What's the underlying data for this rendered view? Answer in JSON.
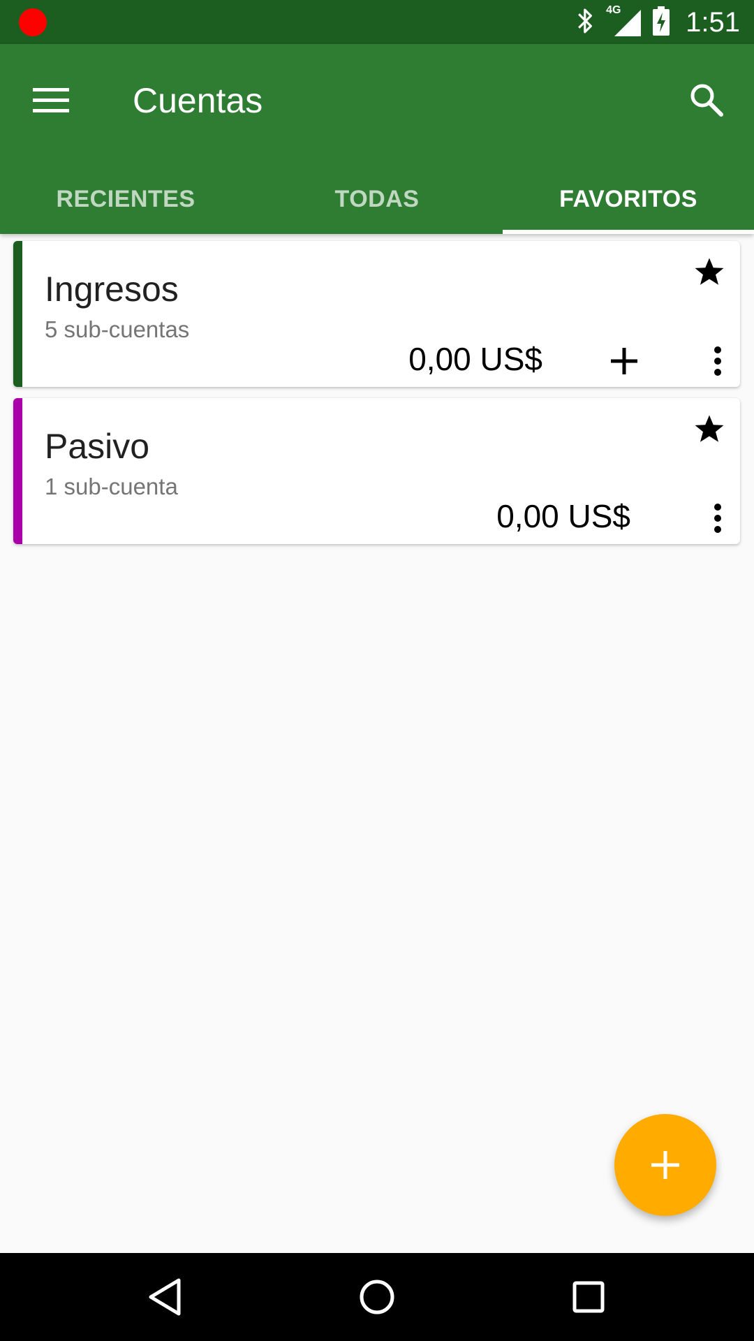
{
  "status_bar": {
    "time": "1:51",
    "network": "4G",
    "icons": [
      "recording-icon",
      "bluetooth-icon",
      "cell-signal-icon",
      "battery-charging-icon"
    ]
  },
  "app_bar": {
    "title": "Cuentas",
    "menu_icon": "hamburger-menu-icon",
    "search_icon": "search-icon"
  },
  "tabs": [
    {
      "label": "RECIENTES",
      "active": false
    },
    {
      "label": "TODAS",
      "active": false
    },
    {
      "label": "FAVORITOS",
      "active": true
    }
  ],
  "accounts": [
    {
      "name": "Ingresos",
      "subaccounts": "5 sub-cuentas",
      "balance": "0,00 US$",
      "color": "#1b5e20",
      "favorite": true,
      "has_add": true
    },
    {
      "name": "Pasivo",
      "subaccounts": "1 sub-cuenta",
      "balance": "0,00 US$",
      "color": "#aa00aa",
      "favorite": true,
      "has_add": false
    }
  ],
  "fab": {
    "icon": "plus-icon"
  },
  "nav_bar": {
    "icons": [
      "back-icon",
      "home-icon",
      "recents-icon"
    ]
  },
  "colors": {
    "status_bar": "#1b5e20",
    "app_bar": "#2e7d32",
    "fab": "#ffab00",
    "background": "#fafafa"
  }
}
